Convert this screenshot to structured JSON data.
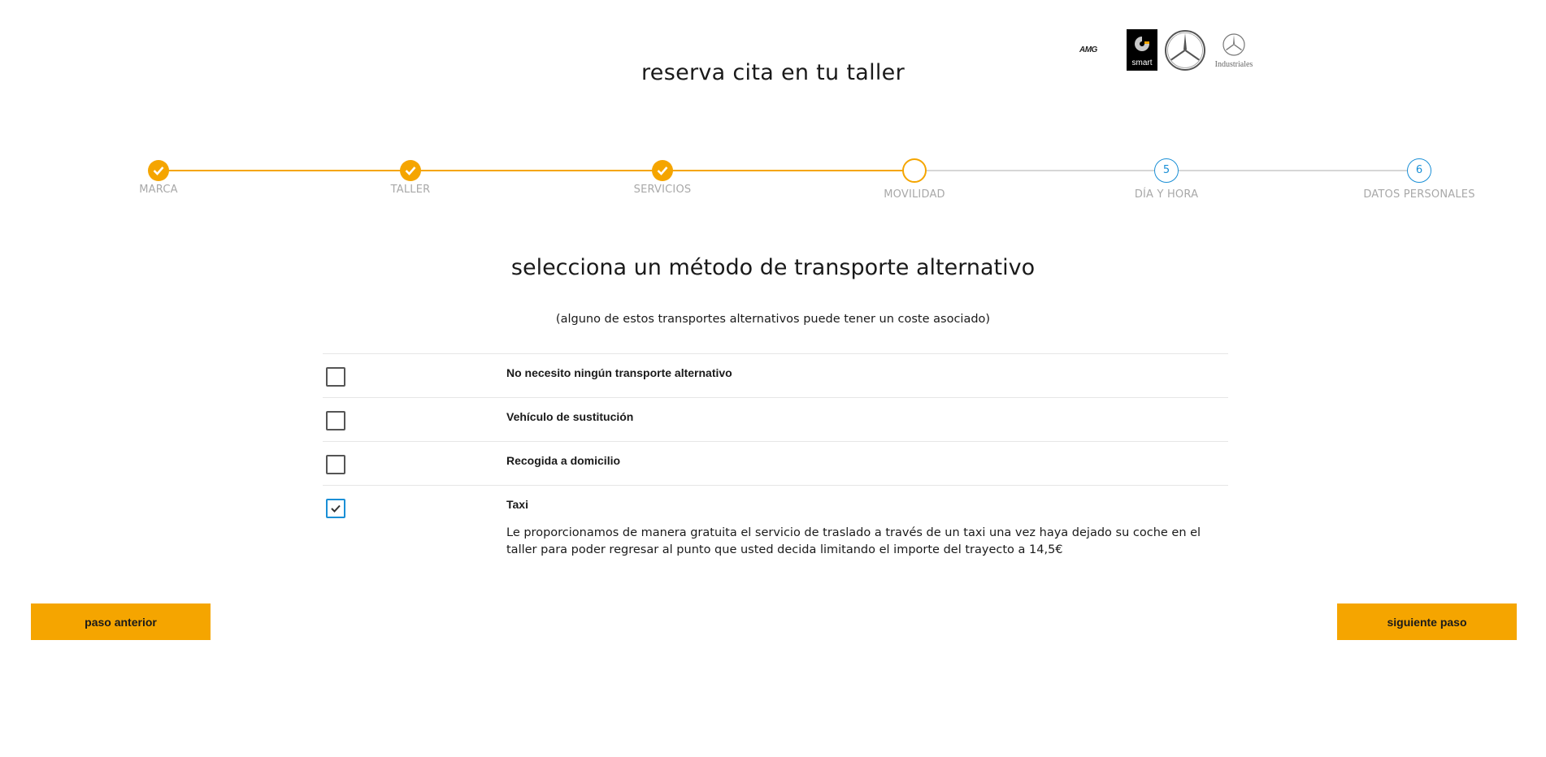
{
  "header": {
    "title": "reserva cita en tu taller",
    "brands": {
      "amg": "AMG",
      "smart": "smart",
      "industriales": "Industriales"
    }
  },
  "colors": {
    "accent": "#f5a500",
    "pending_step": "#1a8fd6",
    "checkbox_checked": "#1a8fd6",
    "inactive_line": "#d6d6d6",
    "label_gray": "#a8a8a8"
  },
  "stepper": {
    "steps": [
      {
        "label": "MARCA",
        "state": "done",
        "number": ""
      },
      {
        "label": "TALLER",
        "state": "done",
        "number": ""
      },
      {
        "label": "SERVICIOS",
        "state": "done",
        "number": ""
      },
      {
        "label": "MOVILIDAD",
        "state": "current",
        "number": ""
      },
      {
        "label": "DÍA Y HORA",
        "state": "todo",
        "number": "5"
      },
      {
        "label": "DATOS PERSONALES",
        "state": "todo",
        "number": "6"
      }
    ]
  },
  "section": {
    "title": "selecciona un método de transporte alternativo",
    "subtitle": "(alguno de estos transportes alternativos puede tener un coste asociado)"
  },
  "options": [
    {
      "label": "No necesito ningún transporte alternativo",
      "checked": false,
      "description": ""
    },
    {
      "label": "Vehículo de sustitución",
      "checked": false,
      "description": ""
    },
    {
      "label": "Recogida a domicilio",
      "checked": false,
      "description": ""
    },
    {
      "label": "Taxi",
      "checked": true,
      "description": "Le proporcionamos de manera gratuita el servicio de traslado a través de un taxi una vez haya dejado su coche en el taller para poder regresar al punto que usted decida limitando el importe del trayecto a 14,5€"
    }
  ],
  "buttons": {
    "prev_label": "paso anterior",
    "next_label": "siguiente paso"
  }
}
